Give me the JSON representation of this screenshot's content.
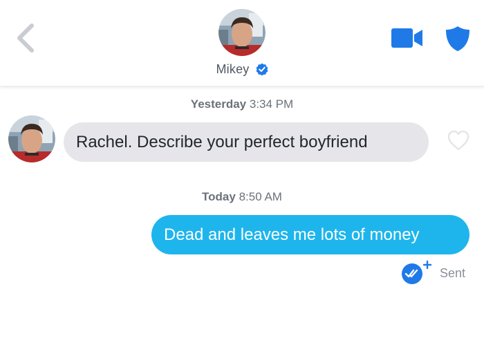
{
  "header": {
    "contact_name": "Mikey",
    "icons": {
      "back": "chevron-left-icon",
      "verified": "verified-badge-icon",
      "video": "video-camera-icon",
      "safety": "shield-icon"
    },
    "colors": {
      "accent": "#1f7ae8",
      "back_chevron": "#c9ccd1",
      "name_text": "#505965"
    }
  },
  "conversation": {
    "timestamps": [
      {
        "day": "Yesterday",
        "time": "3:34 PM"
      },
      {
        "day": "Today",
        "time": "8:50 AM"
      }
    ],
    "messages": [
      {
        "direction": "incoming",
        "text": "Rachel. Describe your perfect boyfriend",
        "reaction_icon": "heart-outline-icon",
        "bubble_color": "#e6e6ea"
      },
      {
        "direction": "outgoing",
        "text": "Dead and leaves me lots of money",
        "status": "Sent",
        "status_icon": "double-check-add-icon",
        "bubble_color": "#1eb5ec"
      }
    ]
  }
}
